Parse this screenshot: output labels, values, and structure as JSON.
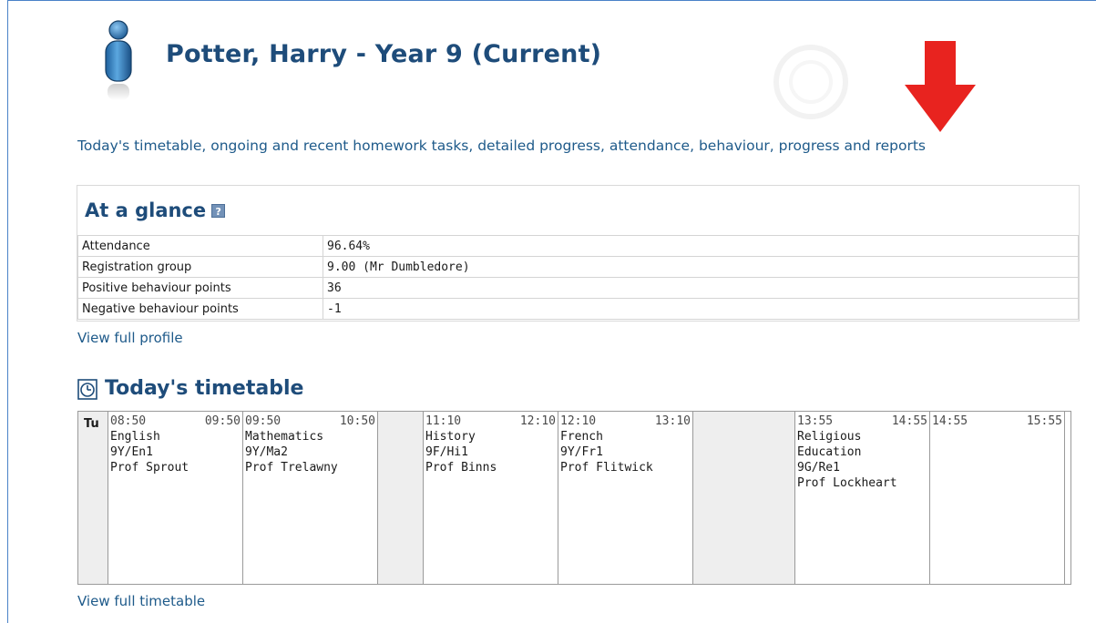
{
  "header": {
    "title": "Potter, Harry - Year 9 (Current)",
    "intro": "Today's timetable, ongoing and recent homework tasks, detailed progress, attendance, behaviour, progress and reports"
  },
  "glance": {
    "title": "At a glance",
    "help_symbol": "?",
    "rows": [
      {
        "label": "Attendance",
        "value": "96.64%"
      },
      {
        "label": "Registration group",
        "value": "9.00 (Mr Dumbledore)"
      },
      {
        "label": "Positive behaviour points",
        "value": "36"
      },
      {
        "label": "Negative behaviour points",
        "value": "-1"
      }
    ],
    "view_profile": "View full profile"
  },
  "timetable": {
    "title": "Today's timetable",
    "day": "Tu",
    "lessons": [
      {
        "start": "08:50",
        "end": "09:50",
        "lines": [
          "English",
          "9Y/En1",
          "Prof Sprout"
        ]
      },
      {
        "start": "09:50",
        "end": "10:50",
        "lines": [
          "Mathematics",
          "9Y/Ma2",
          "Prof Trelawny"
        ]
      },
      {
        "start": "11:10",
        "end": "12:10",
        "lines": [
          "History",
          "9F/Hi1",
          "Prof Binns"
        ]
      },
      {
        "start": "12:10",
        "end": "13:10",
        "lines": [
          "French",
          "9Y/Fr1",
          "Prof Flitwick"
        ]
      },
      {
        "start": "13:55",
        "end": "14:55",
        "lines": [
          "Religious",
          "Education",
          "9G/Re1",
          "Prof Lockheart"
        ]
      },
      {
        "start": "14:55",
        "end": "15:55",
        "lines": []
      }
    ],
    "view_full": "View full timetable"
  },
  "colors": {
    "title": "#1e4c7a",
    "link": "#1e5a8a",
    "arrow": "#e8231f",
    "gap_fill": "#eeeeee"
  }
}
